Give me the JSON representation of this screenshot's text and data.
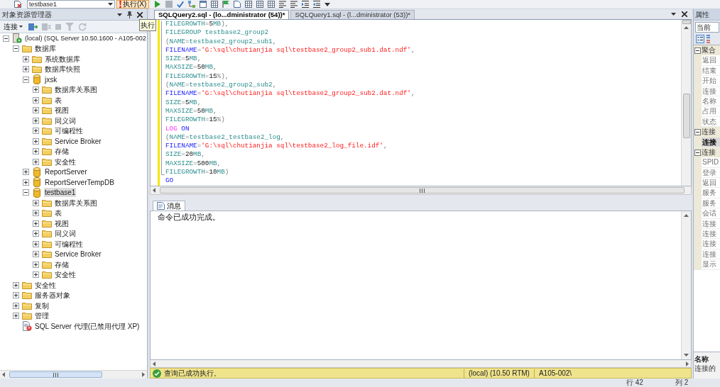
{
  "toolbar": {
    "database": "testbase1",
    "execute_label": "执行(X)"
  },
  "tooltip": "执行",
  "object_explorer": {
    "title": "对象资源管理器",
    "connect_label": "连接",
    "tools": [
      {
        "kind": "connect",
        "disabled": false
      },
      {
        "kind": "disconnect",
        "disabled": true
      },
      {
        "kind": "stop",
        "disabled": true
      },
      {
        "kind": "filter",
        "disabled": true
      },
      {
        "kind": "refresh",
        "disabled": true
      }
    ],
    "tree": [
      {
        "kind": "server",
        "label": "(local) (SQL Server 10.50.1600 - A105-002",
        "expanded": true,
        "selected": false,
        "children": [
          {
            "kind": "folder",
            "label": "数据库",
            "expanded": true,
            "selected": false,
            "children": [
              {
                "kind": "folder",
                "label": "系统数据库",
                "expanded": false,
                "selected": false
              },
              {
                "kind": "folder",
                "label": "数据库快照",
                "expanded": false,
                "selected": false
              },
              {
                "kind": "database",
                "label": "jxsk",
                "expanded": true,
                "selected": false,
                "children": [
                  {
                    "kind": "folder",
                    "label": "数据库关系图",
                    "expanded": false,
                    "selected": false
                  },
                  {
                    "kind": "folder",
                    "label": "表",
                    "expanded": false,
                    "selected": false
                  },
                  {
                    "kind": "folder",
                    "label": "视图",
                    "expanded": false,
                    "selected": false
                  },
                  {
                    "kind": "folder",
                    "label": "同义词",
                    "expanded": false,
                    "selected": false
                  },
                  {
                    "kind": "folder",
                    "label": "可编程性",
                    "expanded": false,
                    "selected": false
                  },
                  {
                    "kind": "folder",
                    "label": "Service Broker",
                    "expanded": false,
                    "selected": false
                  },
                  {
                    "kind": "folder",
                    "label": "存储",
                    "expanded": false,
                    "selected": false
                  },
                  {
                    "kind": "folder",
                    "label": "安全性",
                    "expanded": false,
                    "selected": false
                  }
                ]
              },
              {
                "kind": "database",
                "label": "ReportServer",
                "expanded": false,
                "selected": false
              },
              {
                "kind": "database",
                "label": "ReportServerTempDB",
                "expanded": false,
                "selected": false
              },
              {
                "kind": "database",
                "label": "testbase1",
                "expanded": true,
                "selected": true,
                "children": [
                  {
                    "kind": "folder",
                    "label": "数据库关系图",
                    "expanded": false,
                    "selected": false
                  },
                  {
                    "kind": "folder",
                    "label": "表",
                    "expanded": false,
                    "selected": false
                  },
                  {
                    "kind": "folder",
                    "label": "视图",
                    "expanded": false,
                    "selected": false
                  },
                  {
                    "kind": "folder",
                    "label": "同义词",
                    "expanded": false,
                    "selected": false
                  },
                  {
                    "kind": "folder",
                    "label": "可编程性",
                    "expanded": false,
                    "selected": false
                  },
                  {
                    "kind": "folder",
                    "label": "Service Broker",
                    "expanded": false,
                    "selected": false
                  },
                  {
                    "kind": "folder",
                    "label": "存储",
                    "expanded": false,
                    "selected": false
                  },
                  {
                    "kind": "folder",
                    "label": "安全性",
                    "expanded": false,
                    "selected": false
                  }
                ]
              }
            ]
          },
          {
            "kind": "folder",
            "label": "安全性",
            "expanded": false,
            "selected": false
          },
          {
            "kind": "folder",
            "label": "服务器对象",
            "expanded": false,
            "selected": false
          },
          {
            "kind": "folder",
            "label": "复制",
            "expanded": false,
            "selected": false
          },
          {
            "kind": "folder",
            "label": "管理",
            "expanded": false,
            "selected": false
          },
          {
            "kind": "agent",
            "label": "SQL Server 代理(已禁用代理 XP)",
            "selected": false
          }
        ]
      }
    ]
  },
  "editor": {
    "tabs": [
      {
        "label": "SQLQuery2.sql - (lo...dministrator (54))*",
        "selected": true
      },
      {
        "label": "SQLQuery1.sql - (l...dministrator (53))*",
        "selected": false
      }
    ],
    "lines": [
      [
        {
          "kind": "name",
          "text": "FILEGROWTH"
        },
        {
          "kind": "op",
          "text": "="
        },
        {
          "kind": "number",
          "text": "5"
        },
        {
          "kind": "name",
          "text": "MB"
        },
        {
          "kind": "op",
          "text": "),"
        }
      ],
      [
        {
          "kind": "name",
          "text": "FILEGROUP testbase2_group2"
        }
      ],
      [
        {
          "kind": "op",
          "text": "("
        },
        {
          "kind": "name",
          "text": "NAME"
        },
        {
          "kind": "op",
          "text": "="
        },
        {
          "kind": "name",
          "text": "testbase2_group2_sub1"
        },
        {
          "kind": "op",
          "text": ","
        }
      ],
      [
        {
          "kind": "keyword",
          "text": "FILENAME"
        },
        {
          "kind": "op",
          "text": "="
        },
        {
          "kind": "string",
          "text": "'G:\\sql\\chutianjia sql\\testbase2_group2_sub1.dat.ndf'"
        },
        {
          "kind": "op",
          "text": ","
        }
      ],
      [
        {
          "kind": "name",
          "text": "SIZE"
        },
        {
          "kind": "op",
          "text": "="
        },
        {
          "kind": "number",
          "text": "5"
        },
        {
          "kind": "name",
          "text": "MB"
        },
        {
          "kind": "op",
          "text": ","
        }
      ],
      [
        {
          "kind": "name",
          "text": "MAXSIZE"
        },
        {
          "kind": "op",
          "text": "="
        },
        {
          "kind": "number",
          "text": "50"
        },
        {
          "kind": "name",
          "text": "MB"
        },
        {
          "kind": "op",
          "text": ","
        }
      ],
      [
        {
          "kind": "name",
          "text": "FILEGROWTH"
        },
        {
          "kind": "op",
          "text": "="
        },
        {
          "kind": "number",
          "text": "15"
        },
        {
          "kind": "op",
          "text": "%),"
        }
      ],
      [
        {
          "kind": "op",
          "text": "("
        },
        {
          "kind": "name",
          "text": "NAME"
        },
        {
          "kind": "op",
          "text": "="
        },
        {
          "kind": "name",
          "text": "testbase2_group2_sub2"
        },
        {
          "kind": "op",
          "text": ","
        }
      ],
      [
        {
          "kind": "keyword",
          "text": "FILENAME"
        },
        {
          "kind": "op",
          "text": "="
        },
        {
          "kind": "string",
          "text": "'G:\\sql\\chutianjia sql\\testbase2_group2_sub2.dat.ndf'"
        },
        {
          "kind": "op",
          "text": ","
        }
      ],
      [
        {
          "kind": "name",
          "text": "SIZE"
        },
        {
          "kind": "op",
          "text": "="
        },
        {
          "kind": "number",
          "text": "5"
        },
        {
          "kind": "name",
          "text": "MB"
        },
        {
          "kind": "op",
          "text": ","
        }
      ],
      [
        {
          "kind": "name",
          "text": "MAXSIZE"
        },
        {
          "kind": "op",
          "text": "="
        },
        {
          "kind": "number",
          "text": "50"
        },
        {
          "kind": "name",
          "text": "MB"
        },
        {
          "kind": "op",
          "text": ","
        }
      ],
      [
        {
          "kind": "name",
          "text": "FILEGROWTH"
        },
        {
          "kind": "op",
          "text": "="
        },
        {
          "kind": "number",
          "text": "15"
        },
        {
          "kind": "op",
          "text": "%)"
        }
      ],
      [
        {
          "kind": "function",
          "text": "LOG "
        },
        {
          "kind": "keyword",
          "text": "ON"
        }
      ],
      [
        {
          "kind": "op",
          "text": "("
        },
        {
          "kind": "name",
          "text": "NAME"
        },
        {
          "kind": "op",
          "text": "="
        },
        {
          "kind": "name",
          "text": "testbase2_testbase2_log"
        },
        {
          "kind": "op",
          "text": ","
        }
      ],
      [
        {
          "kind": "keyword",
          "text": "FILENAME"
        },
        {
          "kind": "op",
          "text": "="
        },
        {
          "kind": "string",
          "text": "'G:\\sql\\chutianjia sql\\testbase2_log_file.idf'"
        },
        {
          "kind": "op",
          "text": ","
        }
      ],
      [
        {
          "kind": "name",
          "text": "SIZE"
        },
        {
          "kind": "op",
          "text": "="
        },
        {
          "kind": "number",
          "text": "20"
        },
        {
          "kind": "name",
          "text": "MB"
        },
        {
          "kind": "op",
          "text": ","
        }
      ],
      [
        {
          "kind": "name",
          "text": "MAXSIZE"
        },
        {
          "kind": "op",
          "text": "="
        },
        {
          "kind": "number",
          "text": "500"
        },
        {
          "kind": "name",
          "text": "MB"
        },
        {
          "kind": "op",
          "text": ","
        }
      ],
      [
        {
          "kind": "name",
          "text": "FILEGROWTH"
        },
        {
          "kind": "op",
          "text": "="
        },
        {
          "kind": "number",
          "text": "10"
        },
        {
          "kind": "name",
          "text": "MB"
        },
        {
          "kind": "op",
          "text": ")"
        }
      ],
      [
        {
          "kind": "keyword",
          "text": "GO"
        }
      ]
    ]
  },
  "results": {
    "tabs": [
      {
        "label": "消息",
        "selected": true
      }
    ],
    "message": "命令已成功完成。"
  },
  "status_bar": {
    "message": "查询已成功执行。",
    "server": "(local) (10.50 RTM)",
    "user": "A105-002\\"
  },
  "position": {
    "line": "行 42",
    "column": "列 2"
  },
  "properties": {
    "title": "属性",
    "object": "当前",
    "sections": [
      {
        "label": "聚合",
        "expanded": true,
        "items": [
          {
            "label": "返回",
            "selected": false
          },
          {
            "label": "结束",
            "selected": false
          },
          {
            "label": "开始",
            "selected": false
          },
          {
            "label": "连接",
            "selected": false
          },
          {
            "label": "名称",
            "selected": false
          },
          {
            "label": "占用",
            "selected": false
          },
          {
            "label": "状态",
            "selected": false
          }
        ]
      },
      {
        "label": "连接",
        "expanded": true,
        "items": [
          {
            "label": "连接",
            "selected": true
          }
        ]
      },
      {
        "label": "连接",
        "expanded": true,
        "items": [
          {
            "label": "SPID",
            "selected": false
          },
          {
            "label": "登录",
            "selected": false
          },
          {
            "label": "返回",
            "selected": false
          },
          {
            "label": "服务",
            "selected": false
          },
          {
            "label": "服务",
            "selected": false
          },
          {
            "label": "会话",
            "selected": false
          },
          {
            "label": "连接",
            "selected": false
          },
          {
            "label": "连接",
            "selected": false
          },
          {
            "label": "连接",
            "selected": false
          },
          {
            "label": "连接",
            "selected": false
          },
          {
            "label": "显示",
            "selected": false
          }
        ]
      }
    ],
    "description_title": "名称",
    "description": "连接的"
  }
}
